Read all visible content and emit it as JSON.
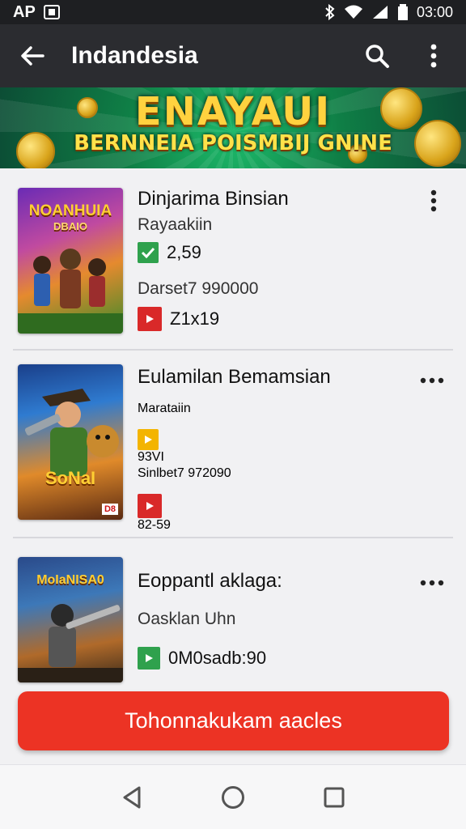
{
  "status_bar": {
    "carrier": "AP",
    "time": "03:00"
  },
  "app_bar": {
    "title": "Indandesia",
    "back_icon": "back-arrow-icon",
    "search_icon": "search-icon",
    "menu_icon": "more-vert-icon"
  },
  "banner": {
    "headline": "ENAYAUI",
    "subline": "BERNNEIA POISMBIJ GNINE",
    "colors": {
      "background": "#138a4e",
      "text": "#ffd23f"
    }
  },
  "items": [
    {
      "name": "Dinjarima Binsian",
      "subtitle": "Rayaakiin",
      "rating_value": "2,59",
      "rating_badge": "check-badge-icon",
      "rating_color": "#2fa14d",
      "details": "Darset7 990000",
      "stat_value": "Z1x19",
      "stat_badge": "play-badge-icon",
      "thumb_title": "NOANHUIA",
      "thumb_sub": "DBAIO",
      "more_icon": "more-vert-icon"
    },
    {
      "name": "Eulamilan Bemamsian",
      "subtitle": "Marataiin",
      "rating_value": "93VI",
      "rating_badge": "play-badge-icon",
      "rating_color": "#f3b400",
      "details": "Sinlbet7 972090",
      "stat_value": "82-59",
      "stat_badge": "play-badge-icon",
      "thumb_title": "SoNaI",
      "thumb_tag": "D8",
      "more_icon": "more-horiz-icon"
    },
    {
      "name": "Eoppantl aklaga:",
      "subtitle": "Oasklan Uhn",
      "stat_value": "0M0sadb:90",
      "stat_badge": "play-badge-icon",
      "stat_color": "#2fa14d",
      "thumb_title": "MoIaNISA0",
      "more_icon": "more-horiz-icon"
    }
  ],
  "cta": {
    "label": "Tohonnakukam aacles",
    "color": "#ec3324"
  },
  "nav": {
    "back_icon": "nav-back-icon",
    "home_icon": "nav-home-icon",
    "recents_icon": "nav-recents-icon"
  }
}
